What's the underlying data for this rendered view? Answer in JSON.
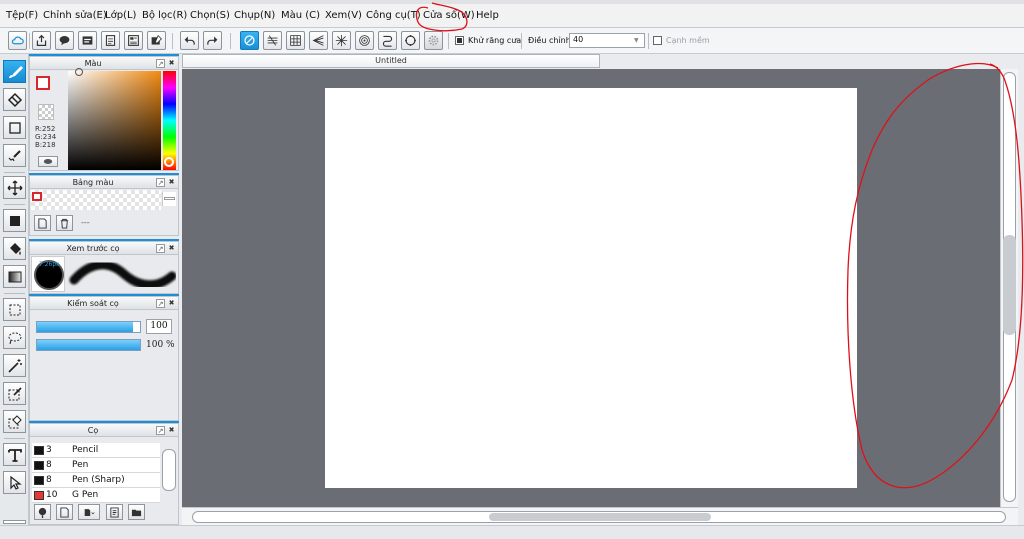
{
  "menu": {
    "items": [
      {
        "key": "file",
        "label": "Tệp(F)"
      },
      {
        "key": "edit",
        "label": "Chỉnh sửa(E)"
      },
      {
        "key": "layer",
        "label": "Lớp(L)"
      },
      {
        "key": "filter",
        "label": "Bộ lọc(R)"
      },
      {
        "key": "select",
        "label": "Chọn(S)"
      },
      {
        "key": "capture",
        "label": "Chụp(N)"
      },
      {
        "key": "color",
        "label": "Màu (C)"
      },
      {
        "key": "view",
        "label": "Xem(V)"
      },
      {
        "key": "tool",
        "label": "Công cụ(T)"
      },
      {
        "key": "window",
        "label": "Cửa sổ(W)"
      },
      {
        "key": "help",
        "label": "Help"
      }
    ]
  },
  "toolbar": {
    "antialias_label": "Khử răng cưa",
    "antialias_checked": true,
    "adjust_label": "Điều chỉnh",
    "adjust_value": "40",
    "smooth_label": "Cạnh mềm",
    "smooth_checked": false
  },
  "panels": {
    "color": {
      "title": "Màu",
      "rgb": {
        "r": "R:252",
        "g": "G:234",
        "b": "B:218"
      },
      "foreground": "#d9262c",
      "background": "#ffffff"
    },
    "palette": {
      "title": "Bảng màu",
      "dashes": "---"
    },
    "brush_preview": {
      "title": "Xem trước cọ",
      "size": "7.26px"
    },
    "brush_control": {
      "title": "Kiểm soát cọ",
      "size_value": "100",
      "opacity_value": "100 %",
      "size_fraction": 0.93,
      "opacity_fraction": 1.0
    },
    "brushes": {
      "title": "Cọ",
      "items": [
        {
          "size": "3",
          "name": "Pencil",
          "color": "#111111"
        },
        {
          "size": "8",
          "name": "Pen",
          "color": "#111111"
        },
        {
          "size": "8",
          "name": "Pen (Sharp)",
          "color": "#111111"
        },
        {
          "size": "10",
          "name": "G Pen",
          "color": "#e53935"
        }
      ]
    }
  },
  "document": {
    "title": "Untitled"
  },
  "colors": {
    "accent": "#1f8ed8",
    "workspace": "#6a6e74",
    "annotation": "#e0101a"
  }
}
